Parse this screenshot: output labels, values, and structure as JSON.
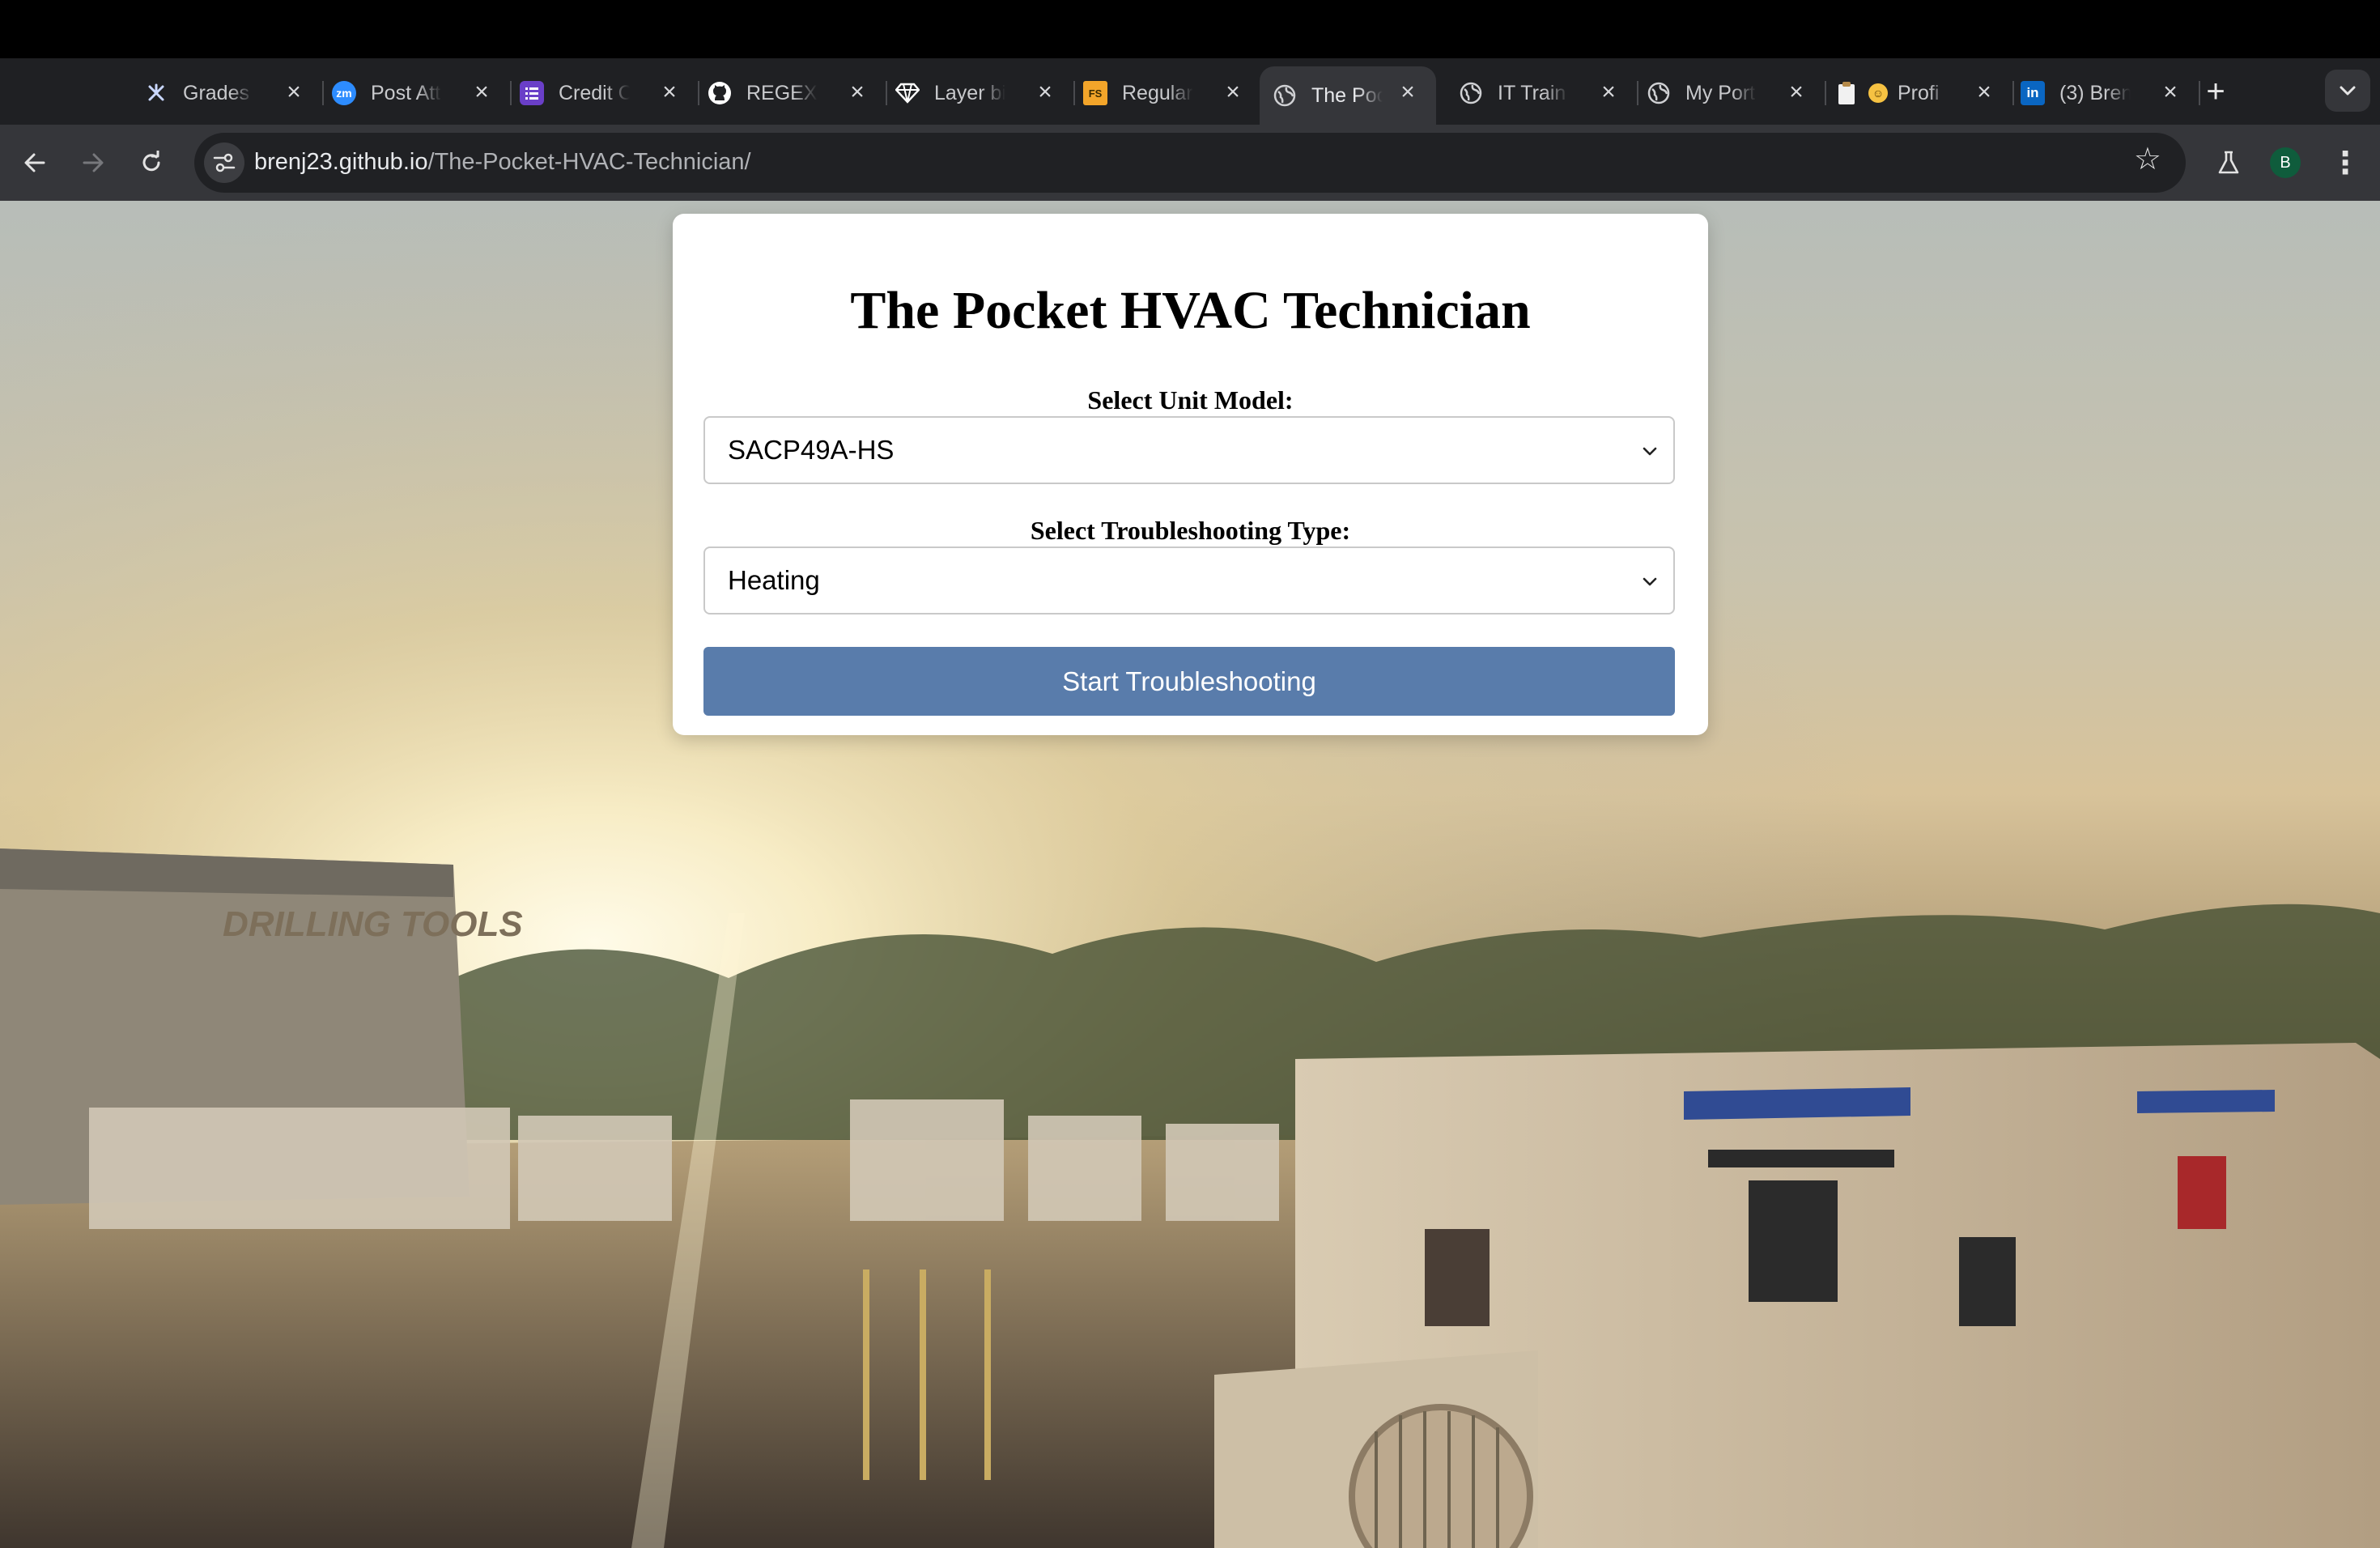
{
  "browser": {
    "tabs": [
      {
        "title": "Grades",
        "icon": "canvas-icon",
        "color": "#1f2023"
      },
      {
        "title": "Post Att",
        "icon": "zoom-icon",
        "color": "#2d8cff"
      },
      {
        "title": "Credit C",
        "icon": "list-icon",
        "color": "#6a3fc8"
      },
      {
        "title": "REGEX.J",
        "icon": "github-icon",
        "color": "#1f2023"
      },
      {
        "title": "Layer bi",
        "icon": "diamond-icon",
        "color": "#1f2023"
      },
      {
        "title": "Regular",
        "icon": "fs-icon",
        "color": "#f3a52a"
      },
      {
        "title": "The Poc",
        "icon": "globe-icon",
        "color": "#1f2023"
      },
      {
        "title": "IT Train",
        "icon": "globe-icon",
        "color": "#1f2023"
      },
      {
        "title": "My Port",
        "icon": "globe-icon",
        "color": "#1f2023"
      },
      {
        "title": "Profi",
        "icon": "clipboard-icon",
        "color": "#1f2023"
      },
      {
        "title": "(3) Bren",
        "icon": "linkedin-icon",
        "color": "#0a66c2"
      }
    ],
    "active_tab": 6,
    "url_host": "brenj23.github.io",
    "url_path": "/The-Pocket-HVAC-Technician/",
    "profile_initial": "B"
  },
  "app": {
    "title": "The Pocket HVAC Technician",
    "unit_label": "Select Unit Model:",
    "unit_value": "SACP49A-HS",
    "type_label": "Select Troubleshooting Type:",
    "type_value": "Heating",
    "start_button": "Start Troubleshooting"
  },
  "background": {
    "sign_text": "DRILLING TOOLS"
  }
}
